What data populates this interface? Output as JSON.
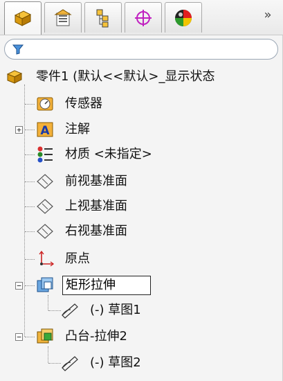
{
  "tabs": [
    {
      "name": "FeatureManager",
      "icon": "feature-manager-icon",
      "active": true
    },
    {
      "name": "PropertyManager",
      "icon": "property-manager-icon",
      "active": false
    },
    {
      "name": "ConfigurationManager",
      "icon": "configuration-manager-icon",
      "active": false
    },
    {
      "name": "DimXpertManager",
      "icon": "dimxpert-icon",
      "active": false
    },
    {
      "name": "DisplayManager",
      "icon": "display-manager-icon",
      "active": false
    }
  ],
  "tab_more": "»",
  "filter": {
    "icon": "filter-icon"
  },
  "tree": {
    "root_label": "零件1  (默认<<默认>_显示状态",
    "items": {
      "sensors": "传感器",
      "annotations": "注解",
      "material": "材质 <未指定>",
      "front_plane": "前视基准面",
      "top_plane": "上视基准面",
      "right_plane": "右视基准面",
      "origin": "原点",
      "extrude_cut": "矩形拉伸",
      "sketch1": "(-) 草图1",
      "boss_extrude": "凸台-拉伸2",
      "sketch2": "(-) 草图2"
    }
  },
  "colors": {
    "panel_bg": "#f4f4f4",
    "accent_orange": "#e8a21a",
    "plane_gray": "#555555",
    "origin_red": "#cc2222"
  }
}
